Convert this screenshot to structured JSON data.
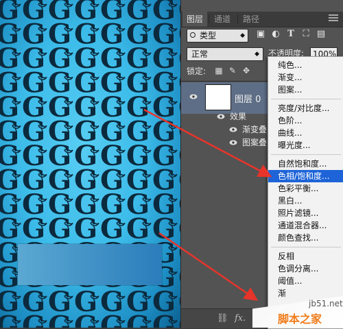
{
  "panel": {
    "tabs": [
      "图层",
      "通道",
      "路径"
    ],
    "filter_label": "类型",
    "blend_mode": "正常",
    "opacity_label": "不透明度:",
    "opacity_value": "100%",
    "lock_label": "锁定:",
    "layer_name": "图层 0",
    "effects_label": "效果",
    "effect_gradient_overlay": "渐变叠",
    "effect_pattern_overlay": "图案叠"
  },
  "menu": {
    "items": [
      "纯色...",
      "渐变...",
      "图案...",
      "亮度/对比度...",
      "色阶...",
      "曲线...",
      "曝光度...",
      "自然饱和度...",
      "色相/饱和度...",
      "色彩平衡...",
      "黑白...",
      "照片滤镜...",
      "通道混合器...",
      "颜色查找...",
      "反相",
      "色调分离...",
      "阈值...",
      "渐"
    ],
    "highlighted": "色相/饱和度..."
  },
  "canvas": {
    "pattern_letter": "G",
    "bg_color": "#3cbbe9",
    "gradient_box_colors": [
      "#5aa8d2",
      "#2a7dbb"
    ]
  },
  "annotations": {
    "arrow_color": "#e8342a"
  },
  "watermark": {
    "url": "jb51.net",
    "name": "脚本之家"
  }
}
